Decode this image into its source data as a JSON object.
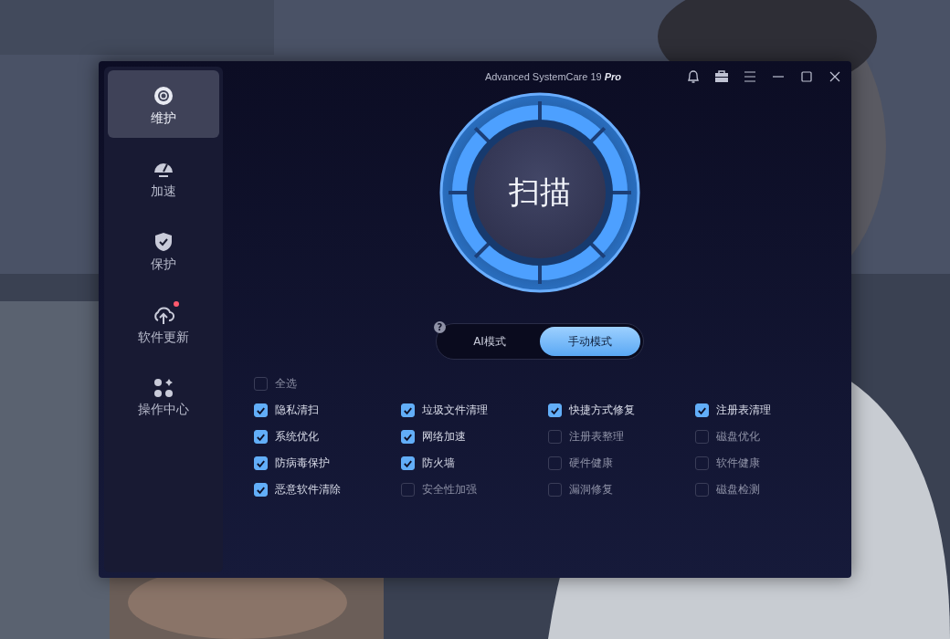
{
  "window": {
    "title": "Advanced SystemCare 19 **Pro**"
  },
  "sidebar": {
    "items": [
      {
        "label": "维护",
        "selected": true,
        "notification": false
      },
      {
        "label": "加速",
        "selected": false,
        "notification": false
      },
      {
        "label": "保护",
        "selected": false,
        "notification": false
      },
      {
        "label": "软件更新",
        "selected": false,
        "notification": true
      },
      {
        "label": "操作中心",
        "selected": false,
        "notification": false
      }
    ]
  },
  "scan_button": {
    "label": "扫描"
  },
  "mode_switch": {
    "help": "?",
    "modes": [
      {
        "label": "AI模式",
        "selected": false
      },
      {
        "label": "手动模式",
        "selected": true
      }
    ]
  },
  "select_all": {
    "label": "全选",
    "checked": false
  },
  "options": [
    {
      "label": "隐私清扫",
      "checked": true
    },
    {
      "label": "垃圾文件清理",
      "checked": true
    },
    {
      "label": "快捷方式修复",
      "checked": true
    },
    {
      "label": "注册表清理",
      "checked": true
    },
    {
      "label": "系统优化",
      "checked": true
    },
    {
      "label": "网络加速",
      "checked": true
    },
    {
      "label": "注册表整理",
      "checked": false
    },
    {
      "label": "磁盘优化",
      "checked": false
    },
    {
      "label": "防病毒保护",
      "checked": true
    },
    {
      "label": "防火墙",
      "checked": true
    },
    {
      "label": "硬件健康",
      "checked": false
    },
    {
      "label": "软件健康",
      "checked": false
    },
    {
      "label": "恶意软件清除",
      "checked": true
    },
    {
      "label": "安全性加强",
      "checked": false
    },
    {
      "label": "漏洞修复",
      "checked": false
    },
    {
      "label": "磁盘检测",
      "checked": false
    }
  ]
}
